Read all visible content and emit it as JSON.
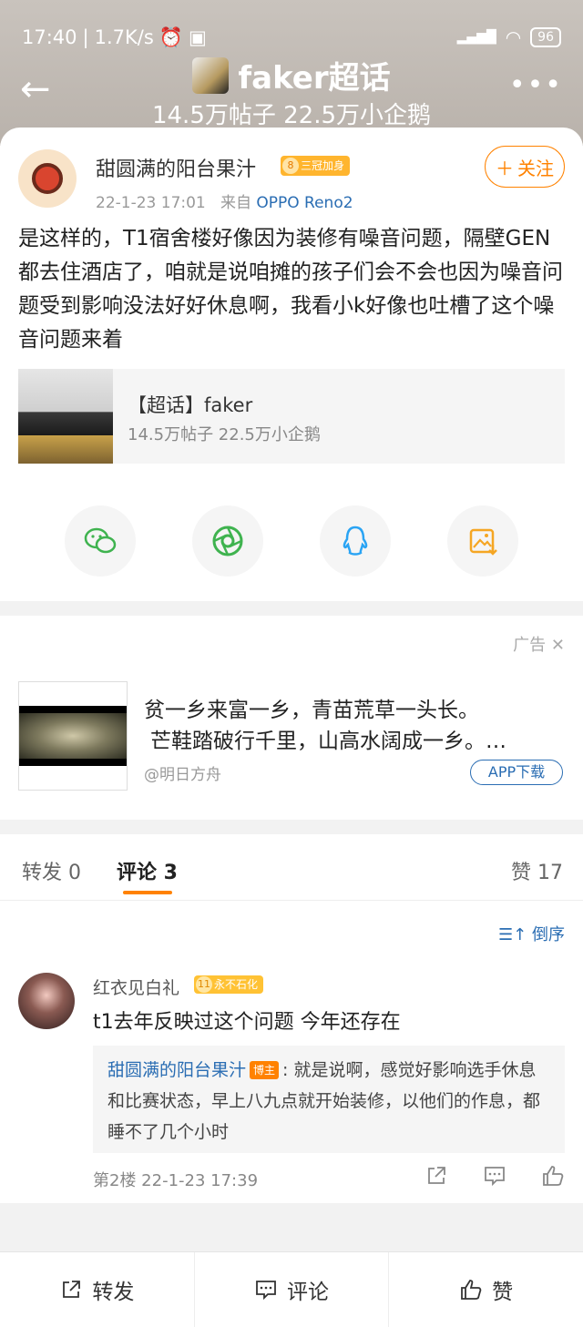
{
  "status": {
    "time": "17:40",
    "speed": "1.7K/s",
    "battery": "96"
  },
  "topic": {
    "title": "faker超话",
    "stats": "14.5万帖子 22.5万小企鹅"
  },
  "post": {
    "author": "甜圆满的阳台果汁",
    "badge_level": "8",
    "badge_text": "三冠加身",
    "date": "22-1-23 17:01",
    "source_prefix": "来自",
    "device": "OPPO Reno2",
    "follow_label": "关注",
    "text": "是这样的，T1宿舍楼好像因为装修有噪音问题，隔壁GEN都去住酒店了，咱就是说咱摊的孩子们会不会也因为噪音问题受到影响没法好好休息啊，我看小k好像也吐槽了这个噪音问题来着",
    "topic_link_title": "【超话】faker",
    "topic_link_stats": "14.5万帖子 22.5万小企鹅"
  },
  "ad": {
    "label": "广告",
    "line1": "贫一乡来富一乡，青苗荒草一头长。",
    "line2": "芒鞋踏破行千里，山高水阔成一乡。…",
    "source": "@明日方舟",
    "download": "APP下载"
  },
  "tabs": {
    "repost": "转发 0",
    "comment": "评论 3",
    "like": "赞 17"
  },
  "sort_label": "倒序",
  "comment": {
    "name": "红衣见白礼",
    "badge_level": "11",
    "badge_text": "永不石化",
    "text": "t1去年反映过这个问题 今年还存在",
    "reply_author": "甜圆满的阳台果汁",
    "reply_tag": "博主",
    "reply_text": ": 就是说啊，感觉好影响选手休息和比赛状态，早上八九点就开始装修，以他们的作息，都睡不了几个小时",
    "meta": "第2楼 22-1-23 17:39"
  },
  "bottom": {
    "repost": "转发",
    "comment": "评论",
    "like": "赞"
  },
  "colors": {
    "accent": "#ff8200",
    "link": "#2a6db3"
  }
}
